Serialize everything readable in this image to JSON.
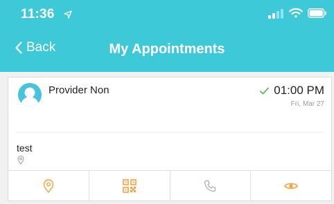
{
  "status_bar": {
    "time": "11:36",
    "icons": [
      "location-arrow-icon",
      "signal-icon",
      "wifi-icon",
      "battery-icon"
    ]
  },
  "nav": {
    "back_label": "Back",
    "title": "My Appointments"
  },
  "appointment": {
    "provider_name": "Provider Non",
    "time": "01:00 PM",
    "date": "Fri, Mar 27",
    "status_icon": "checkmark-icon",
    "note": "test",
    "location_icon": "map-pin-icon",
    "actions": [
      {
        "icon": "location-pin-icon"
      },
      {
        "icon": "qr-code-icon"
      },
      {
        "icon": "phone-icon"
      },
      {
        "icon": "eye-icon"
      }
    ]
  },
  "colors": {
    "header": "#3ec9d9",
    "accent_orange": "#f7a23b",
    "check_green": "#5cb85c",
    "avatar": "#48c3dd"
  }
}
